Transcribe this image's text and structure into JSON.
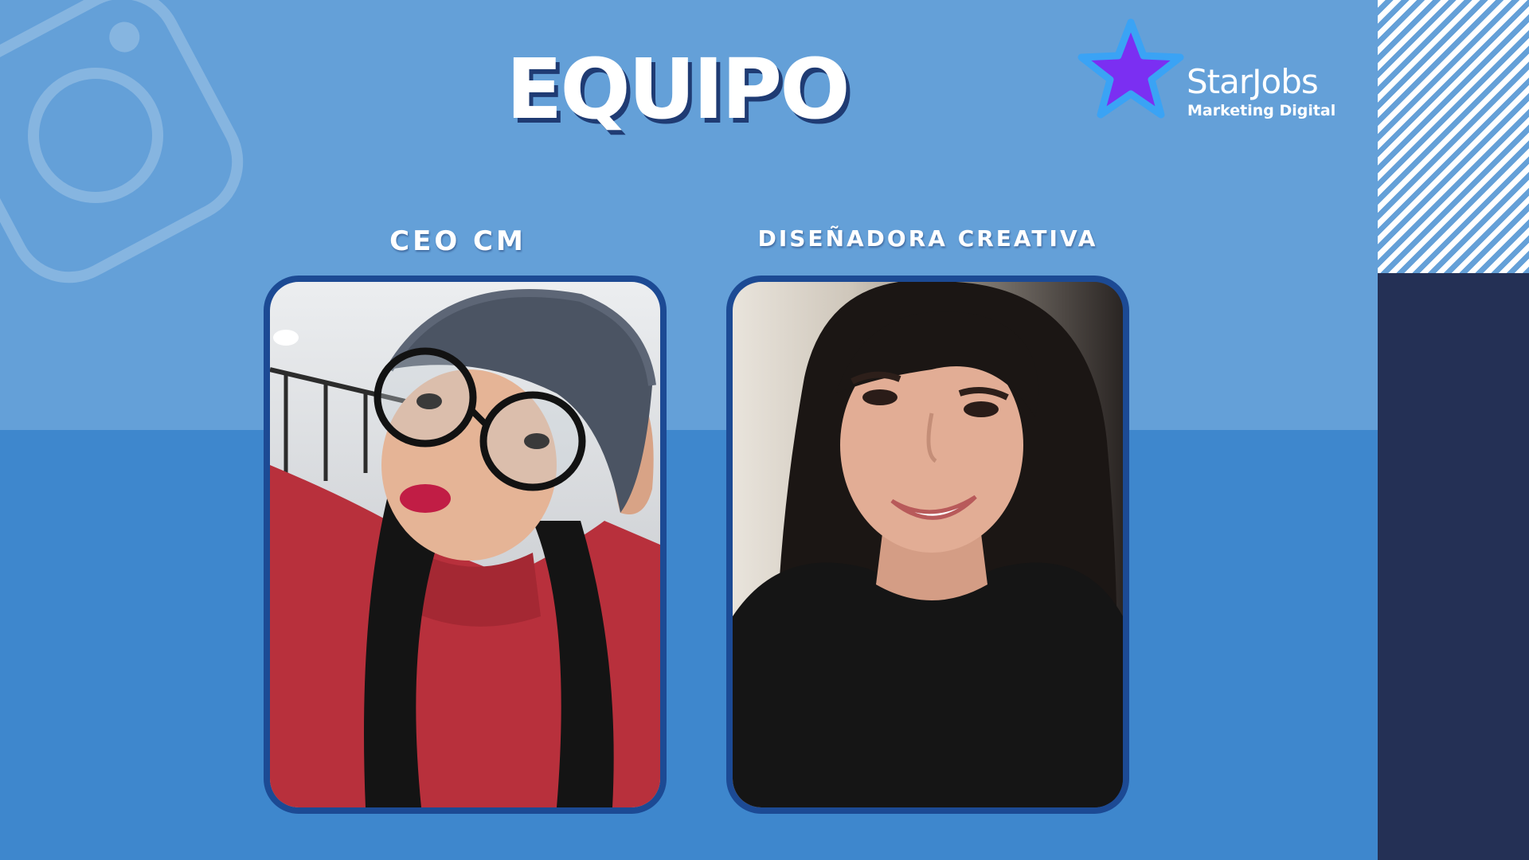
{
  "slide": {
    "title": "EQUIPO",
    "colors": {
      "top_band": "#64a0d8",
      "bottom_band": "#3e87cd",
      "sidebar_navy": "#243055",
      "frame_border": "#1c4a94",
      "star_fill": "#7b2ff2",
      "star_outline": "#3aa3f5",
      "text": "#ffffff"
    }
  },
  "logo": {
    "name": "StarJobs",
    "tagline": "Marketing Digital",
    "icon": "star-icon"
  },
  "decoration": {
    "icon": "camera-icon"
  },
  "team": [
    {
      "role": "CEO CM",
      "photo_icon": "person-photo"
    },
    {
      "role": "DISEÑADORA CREATIVA",
      "photo_icon": "person-photo"
    }
  ]
}
